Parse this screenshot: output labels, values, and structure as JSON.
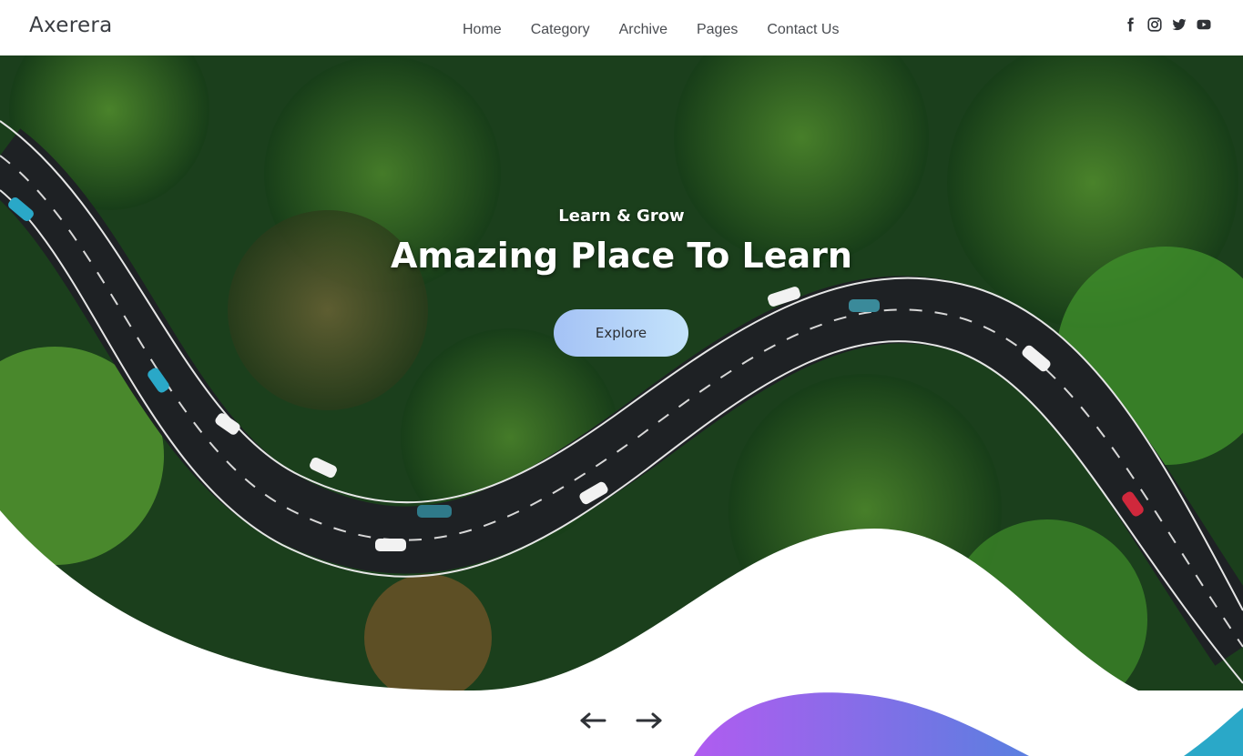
{
  "site": {
    "logo": "Axerera"
  },
  "nav": {
    "items": [
      {
        "label": "Home"
      },
      {
        "label": "Category"
      },
      {
        "label": "Archive"
      },
      {
        "label": "Pages"
      },
      {
        "label": "Contact Us"
      }
    ]
  },
  "social": {
    "icons": [
      "facebook-icon",
      "instagram-icon",
      "twitter-icon",
      "youtube-icon"
    ]
  },
  "hero": {
    "kicker": "Learn & Grow",
    "title": "Amazing Place To Learn",
    "button_label": "Explore"
  },
  "slider": {
    "prev_icon": "arrow-left-icon",
    "next_icon": "arrow-right-icon"
  },
  "colors": {
    "button_gradient_start": "#a4c2f5",
    "button_gradient_end": "#c4e3fb",
    "blob_purple": "#b05cf0",
    "blob_blue": "#5a7fe0",
    "blob_teal": "#2aa8c8"
  }
}
